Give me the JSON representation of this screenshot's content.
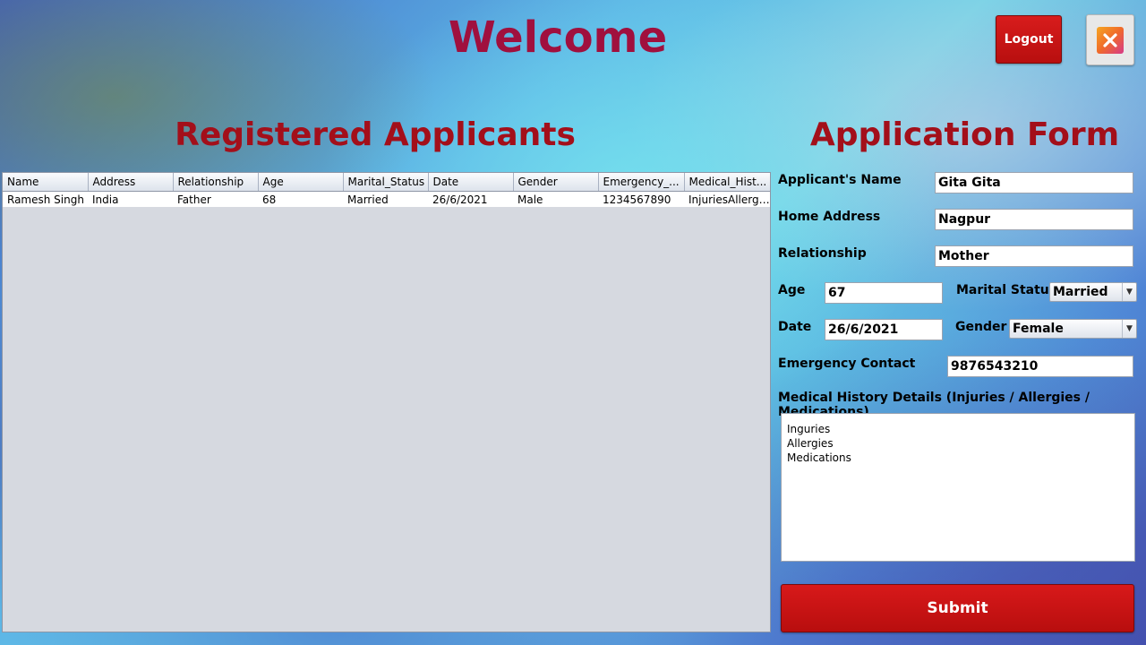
{
  "header": {
    "title": "Welcome",
    "logout_label": "Logout",
    "close_icon": "close-icon"
  },
  "applicants": {
    "heading": "Registered Applicants",
    "columns": [
      "Name",
      "Address",
      "Relationship",
      "Age",
      "Marital_Status",
      "Date",
      "Gender",
      "Emergency_...",
      "Medical_Hist..."
    ],
    "rows": [
      [
        "Ramesh Singh",
        "India",
        "Father",
        "68",
        "Married",
        "26/6/2021",
        "Male",
        "1234567890",
        "InjuriesAllergi..."
      ]
    ]
  },
  "form": {
    "heading": "Application Form",
    "name_label": "Applicant's Name",
    "name_value": "Gita Gita",
    "address_label": "Home Address",
    "address_value": "Nagpur",
    "relationship_label": "Relationship",
    "relationship_value": "Mother",
    "age_label": "Age",
    "age_value": "67",
    "marital_label": "Marital Status",
    "marital_value": "Married",
    "date_label": "Date",
    "date_value": "26/6/2021",
    "gender_label": "Gender",
    "gender_value": "Female",
    "emergency_label": "Emergency Contact",
    "emergency_value": "9876543210",
    "medical_label": "Medical History Details (Injuries / Allergies / Medications)",
    "medical_lines": [
      "Inguries",
      "Allergies",
      "Medications"
    ],
    "submit_label": "Submit"
  },
  "colors": {
    "title": "#a0103e",
    "heading": "#a30f1a",
    "button": "#c81414"
  }
}
